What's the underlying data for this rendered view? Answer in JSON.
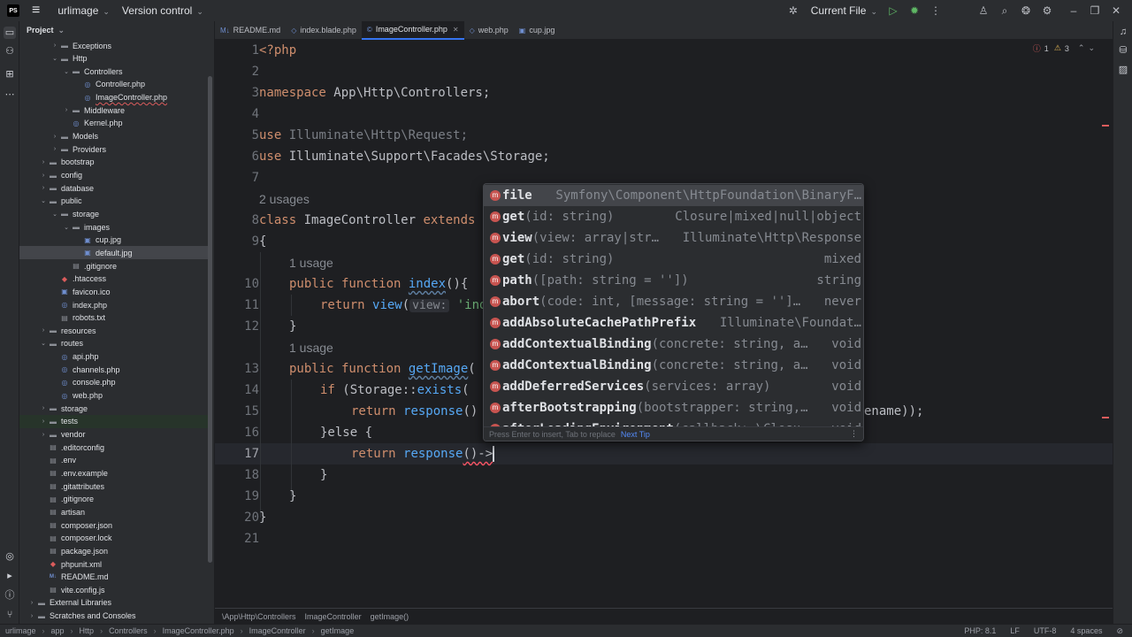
{
  "titlebar": {
    "logo": "PS",
    "project": "urlimage",
    "version_control": "Version control",
    "run_config": "Current File"
  },
  "project_panel": {
    "title": "Project",
    "rows": [
      {
        "label": "Exceptions",
        "type": "folder",
        "depth": 2,
        "arrow": "›"
      },
      {
        "label": "Http",
        "type": "folder",
        "depth": 2,
        "arrow": "⌄"
      },
      {
        "label": "Controllers",
        "type": "folder",
        "depth": 3,
        "arrow": "⌄"
      },
      {
        "label": "Controller.php",
        "type": "php",
        "depth": 4,
        "arrow": ""
      },
      {
        "label": "ImageController.php",
        "type": "php",
        "depth": 4,
        "arrow": "",
        "error": true
      },
      {
        "label": "Middleware",
        "type": "folder",
        "depth": 3,
        "arrow": "›"
      },
      {
        "label": "Kernel.php",
        "type": "php",
        "depth": 3,
        "arrow": ""
      },
      {
        "label": "Models",
        "type": "folder",
        "depth": 2,
        "arrow": "›"
      },
      {
        "label": "Providers",
        "type": "folder",
        "depth": 2,
        "arrow": "›"
      },
      {
        "label": "bootstrap",
        "type": "folder",
        "depth": 1,
        "arrow": "›"
      },
      {
        "label": "config",
        "type": "folder",
        "depth": 1,
        "arrow": "›"
      },
      {
        "label": "database",
        "type": "folder",
        "depth": 1,
        "arrow": "›"
      },
      {
        "label": "public",
        "type": "folder",
        "depth": 1,
        "arrow": "⌄"
      },
      {
        "label": "storage",
        "type": "folder",
        "depth": 2,
        "arrow": "⌄"
      },
      {
        "label": "images",
        "type": "folder",
        "depth": 3,
        "arrow": "⌄"
      },
      {
        "label": "cup.jpg",
        "type": "img",
        "depth": 4,
        "arrow": ""
      },
      {
        "label": "default.jpg",
        "type": "img",
        "depth": 4,
        "arrow": "",
        "selected": true
      },
      {
        "label": ".gitignore",
        "type": "file",
        "depth": 3,
        "arrow": ""
      },
      {
        "label": ".htaccess",
        "type": "red",
        "depth": 2,
        "arrow": ""
      },
      {
        "label": "favicon.ico",
        "type": "img",
        "depth": 2,
        "arrow": ""
      },
      {
        "label": "index.php",
        "type": "php",
        "depth": 2,
        "arrow": ""
      },
      {
        "label": "robots.txt",
        "type": "file",
        "depth": 2,
        "arrow": ""
      },
      {
        "label": "resources",
        "type": "folder",
        "depth": 1,
        "arrow": "›"
      },
      {
        "label": "routes",
        "type": "folder",
        "depth": 1,
        "arrow": "⌄"
      },
      {
        "label": "api.php",
        "type": "php",
        "depth": 2,
        "arrow": ""
      },
      {
        "label": "channels.php",
        "type": "php",
        "depth": 2,
        "arrow": ""
      },
      {
        "label": "console.php",
        "type": "php",
        "depth": 2,
        "arrow": ""
      },
      {
        "label": "web.php",
        "type": "php",
        "depth": 2,
        "arrow": ""
      },
      {
        "label": "storage",
        "type": "folder",
        "depth": 1,
        "arrow": "›"
      },
      {
        "label": "tests",
        "type": "folder",
        "depth": 1,
        "arrow": "›",
        "highlight": true
      },
      {
        "label": "vendor",
        "type": "folder",
        "depth": 1,
        "arrow": "›"
      },
      {
        "label": ".editorconfig",
        "type": "file",
        "depth": 1,
        "arrow": ""
      },
      {
        "label": ".env",
        "type": "file",
        "depth": 1,
        "arrow": ""
      },
      {
        "label": ".env.example",
        "type": "file",
        "depth": 1,
        "arrow": ""
      },
      {
        "label": ".gitattributes",
        "type": "file",
        "depth": 1,
        "arrow": ""
      },
      {
        "label": ".gitignore",
        "type": "file",
        "depth": 1,
        "arrow": ""
      },
      {
        "label": "artisan",
        "type": "file",
        "depth": 1,
        "arrow": ""
      },
      {
        "label": "composer.json",
        "type": "file",
        "depth": 1,
        "arrow": ""
      },
      {
        "label": "composer.lock",
        "type": "file",
        "depth": 1,
        "arrow": ""
      },
      {
        "label": "package.json",
        "type": "file",
        "depth": 1,
        "arrow": ""
      },
      {
        "label": "phpunit.xml",
        "type": "red",
        "depth": 1,
        "arrow": ""
      },
      {
        "label": "README.md",
        "type": "md",
        "depth": 1,
        "arrow": ""
      },
      {
        "label": "vite.config.js",
        "type": "file",
        "depth": 1,
        "arrow": ""
      },
      {
        "label": "External Libraries",
        "type": "folder",
        "depth": 0,
        "arrow": "›"
      },
      {
        "label": "Scratches and Consoles",
        "type": "folder",
        "depth": 0,
        "arrow": "›"
      }
    ]
  },
  "tabs": [
    {
      "label": "README.md",
      "icon": "M↓",
      "active": false
    },
    {
      "label": "index.blade.php",
      "icon": "◇",
      "active": false
    },
    {
      "label": "ImageController.php",
      "icon": "©",
      "active": true
    },
    {
      "label": "web.php",
      "icon": "◇",
      "active": false
    },
    {
      "label": "cup.jpg",
      "icon": "▣",
      "active": false
    }
  ],
  "editor_status": {
    "errors": "1",
    "warnings": "3"
  },
  "line_numbers": [
    "1",
    "2",
    "3",
    "4",
    "5",
    "6",
    "7",
    "8",
    "9",
    "10",
    "11",
    "12",
    "13",
    "14",
    "15",
    "16",
    "17",
    "18",
    "19",
    "20",
    "21"
  ],
  "code": {
    "l1": "<?php",
    "l3_kw": "namespace",
    "l3_rest": " App\\Http\\Controllers;",
    "l5_kw": "use",
    "l5_rest": " Illuminate\\Http\\Request;",
    "l6_kw": "use",
    "l6_rest": " Illuminate\\Support\\Facades\\Storage;",
    "usages_2": "2 usages",
    "l8_kw": "class",
    "l8_name": " ImageController ",
    "l8_kw2": "extends",
    "l9": "{",
    "usage_1a": "1 usage",
    "l10_kw": "public function ",
    "l10_fn": "index",
    "l10_rest": "(){",
    "l11_kw": "return ",
    "l11_fn": "view",
    "l11_p1": "(",
    "l11_inlay": "view:",
    "l11_str": " 'ind",
    "l12": "}",
    "usage_1b": "1 usage",
    "l13_kw": "public function ",
    "l13_fn": "getImage",
    "l13_rest": "(",
    "l14_kw": "if ",
    "l14_rest": "(Storage::",
    "l14_fn": "exists",
    "l14_tail": "(",
    "l15_kw": "return ",
    "l15_fn": "response",
    "l15_rest": "()",
    "l15_tail": "ename));",
    "l16": "}else {",
    "l17_kw": "return ",
    "l17_fn": "response",
    "l17_rest": "()->",
    "l18": "}",
    "l19": "}",
    "l20": "}"
  },
  "completion": {
    "items": [
      {
        "name": "file",
        "sig": "",
        "ret": "Symfony\\Component\\HttpFoundation\\BinaryF…"
      },
      {
        "name": "get",
        "sig": "(id: string)",
        "ret": "Closure|mixed|null|object"
      },
      {
        "name": "view",
        "sig": "(view: array|str…",
        "ret": "Illuminate\\Http\\Response"
      },
      {
        "name": "get",
        "sig": "(id: string)",
        "ret": "mixed"
      },
      {
        "name": "path",
        "sig": "([path: string = ''])",
        "ret": "string"
      },
      {
        "name": "abort",
        "sig": "(code: int, [message: string = '']…",
        "ret": "never"
      },
      {
        "name": "addAbsoluteCachePathPrefix",
        "sig": "",
        "ret": "Illuminate\\Foundat…"
      },
      {
        "name": "addContextualBinding",
        "sig": "(concrete: string, a…",
        "ret": "void"
      },
      {
        "name": "addContextualBinding",
        "sig": "(concrete: string, a…",
        "ret": "void"
      },
      {
        "name": "addDeferredServices",
        "sig": "(services: array)",
        "ret": "void"
      },
      {
        "name": "afterBootstrapping",
        "sig": "(bootstrapper: string,…",
        "ret": "void"
      },
      {
        "name": "afterLoadingEnvironment",
        "sig": "(callback: \\Closu…",
        "ret": "void"
      }
    ],
    "footer_hint": "Press Enter to insert, Tab to replace",
    "next_tip": "Next Tip",
    "more": "⋮"
  },
  "breadcrumbs": [
    "\\App\\Http\\Controllers",
    "ImageController",
    "getImage()"
  ],
  "statusbar": {
    "path": [
      "urlimage",
      "app",
      "Http",
      "Controllers",
      "ImageController.php",
      "ImageController",
      "getImage"
    ],
    "php": "PHP: 8.1",
    "line_sep": "LF",
    "encoding": "UTF-8",
    "indent": "4 spaces"
  }
}
